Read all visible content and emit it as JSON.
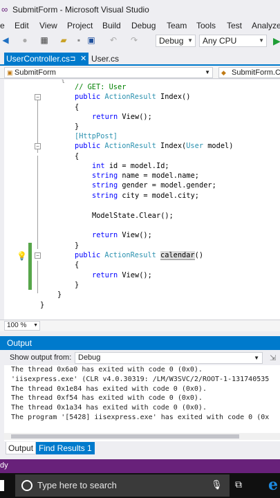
{
  "window": {
    "title": "SubmitForm - Microsoft Visual Studio"
  },
  "menu": [
    "e",
    "Edit",
    "View",
    "Project",
    "Build",
    "Debug",
    "Team",
    "Tools",
    "Test",
    "Analyze"
  ],
  "toolbar": {
    "config": "Debug",
    "platform": "Any CPU"
  },
  "tabs": [
    {
      "label": "UserController.cs",
      "pin": "⊐",
      "close": "✕"
    },
    {
      "label": "User.cs"
    }
  ],
  "nav": {
    "left": "SubmitForm",
    "right": "SubmitForm.C"
  },
  "code": {
    "comment": "// GET: User",
    "l_public": "public",
    "l_actionresult": "ActionResult",
    "m_index": "Index()",
    "open": "{",
    "close": "}",
    "return_kw": "return",
    "return_rest": "View();",
    "attr_httppost": "[HttpPost]",
    "m_index2": "Index(",
    "t_user": "User",
    "m_index2_rest": "model)",
    "kw_int": "int",
    "s_id": "id = model.Id;",
    "kw_string": "string",
    "s_name": "name = model.name;",
    "s_gender": "gender = model.gender;",
    "s_city": "city = model.city;",
    "s_clear": "ModelState.Clear();",
    "m_calendar": "calendar",
    "m_calendar_rest": "()"
  },
  "editor": {
    "zoom": "100 %"
  },
  "output": {
    "header": "Output",
    "show_label": "Show output from:",
    "source": "Debug",
    "lines": [
      "The thread 0x6a0 has exited with code 0 (0x0).",
      "'iisexpress.exe' (CLR v4.0.30319: /LM/W3SVC/2/ROOT-1-131740535",
      "The thread 0x1e84 has exited with code 0 (0x0).",
      "The thread 0xf54 has exited with code 0 (0x0).",
      "The thread 0x1a34 has exited with code 0 (0x0).",
      "The program '[5428] iisexpress.exe' has exited with code 0 (0x"
    ]
  },
  "bottom_tabs": [
    "Output",
    "Find Results 1"
  ],
  "status": {
    "text": "dy"
  },
  "taskbar": {
    "search_placeholder": "Type here to search"
  },
  "colors": {
    "accent": "#007acc",
    "status": "#68217a",
    "keyword": "#0000ff",
    "type": "#2b91af",
    "comment": "#008000"
  }
}
